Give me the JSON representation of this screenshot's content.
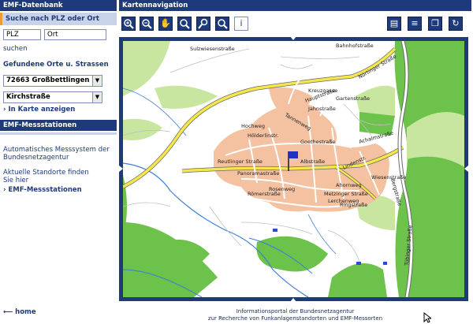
{
  "left": {
    "db_title": "EMF-Datenbank",
    "search_heading": "Suche nach PLZ oder Ort",
    "plz_placeholder": "PLZ",
    "ort_placeholder": "Ort",
    "search_link": "suchen",
    "found_heading": "Gefundene Orte u. Strassen",
    "place_select": "72663 Großbettlingen",
    "street_select": "Kirchstraße",
    "show_map_link": "In Karte anzeigen",
    "stations_title": "EMF-Messstationen",
    "stations_text_1": "Automatisches Messsystem der Bundesnetzagentur",
    "stations_text_2": "Aktuelle Standorte finden Sie hier",
    "stations_link": "EMF-Messstationen",
    "home_link": "home"
  },
  "right": {
    "title": "Kartennavigation",
    "tools_left": [
      "zoom-in-icon",
      "zoom-out-icon",
      "pan-hand-icon",
      "zoom-area-icon",
      "measure-icon",
      "search-map-icon",
      "info-icon"
    ],
    "tools_right": [
      "print-icon",
      "list-icon",
      "copy-icon",
      "refresh-icon"
    ],
    "footer_1": "Informationsportal der Bundesnetzagentur",
    "footer_2": "zur Recherche von Funkanlagenstandorten und EMF-Messorten"
  },
  "map_labels": {
    "sulzwiesen": "Sulzwiesenstraße",
    "bahnhof": "Bahnhofstraße",
    "nuertinger": "Nürtinger Straße",
    "kreuzgasse": "Kreuzgasse",
    "gartenstr": "Gartenstraße",
    "hauptstr": "Hauptstraße",
    "jahnstr": "Jahnstraße",
    "tannenweg": "Tannenweg",
    "hochweg": "Hochweg",
    "hoelderlinstr": "Hölderlinstr.",
    "goethestr": "Goethestraße",
    "achalmstr": "Achalmstraße",
    "reutlinger": "Reutlinger Straße",
    "albstr": "Albstraße",
    "lindenstr": "Lindenstr.",
    "rosenweg": "Rosenweg",
    "ahornweg": "Ahornweg",
    "metzinger": "Metzinger Straße",
    "ringstr": "Ringstraße",
    "roemerstr": "Römerstraße",
    "bergstr": "Bergstraße",
    "wiesenstr": "Wiesenstraße",
    "lerchenweg": "Lerchenweg",
    "panoramastr": "Panoramastraße",
    "tuebinger": "Tübinger Straße"
  },
  "colors": {
    "header": "#1f3a7a",
    "sub": "#c9d3e8",
    "forest": "#6cc24a",
    "meadow": "#c8e6a0",
    "urban": "#f4c2a0",
    "road_main": "#f5e64a"
  }
}
